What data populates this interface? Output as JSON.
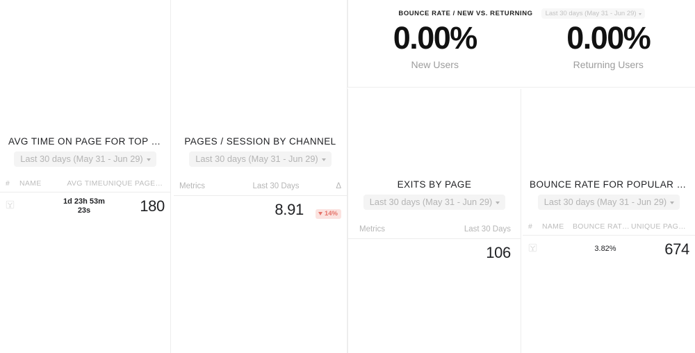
{
  "dashboard": {
    "panels": [
      {
        "id": "avg-time-on-page",
        "title": "AVG TIME ON PAGE FOR TOP PAG…",
        "date_range": "Last 30 days (May 31 - Jun 29)",
        "columns": [
          "#",
          "NAME",
          "AVG TIME",
          "UNIQUE PAGEVI…"
        ],
        "rows": [
          {
            "icon": "favicon-placeholder-icon",
            "name": "",
            "avg_time": "1d 23h 53m 23s",
            "unique_pageviews": "180"
          }
        ]
      },
      {
        "id": "pages-per-session-by-channel",
        "title": "PAGES / SESSION BY CHANNEL",
        "date_range": "Last 30 days (May 31 - Jun 29)",
        "columns": [
          "Metrics",
          "Last 30 Days",
          "Δ"
        ],
        "rows": [
          {
            "metric": "",
            "value": "8.91",
            "delta": "14%",
            "delta_direction": "down"
          }
        ]
      },
      {
        "id": "bounce-rate-new-vs-returning",
        "title": "BOUNCE RATE / NEW VS. RETURNING",
        "date_range": "Last 30 days (May 31 - Jun 29)",
        "stats": [
          {
            "value": "0.00%",
            "label": "New Users"
          },
          {
            "value": "0.00%",
            "label": "Returning Users"
          }
        ]
      },
      {
        "id": "exits-by-page",
        "title": "EXITS BY PAGE",
        "date_range": "Last 30 days (May 31 - Jun 29)",
        "columns": [
          "Metrics",
          "Last 30 Days"
        ],
        "rows": [
          {
            "metric": "",
            "value": "106"
          }
        ]
      },
      {
        "id": "bounce-rate-popular-pages",
        "title": "BOUNCE RATE FOR POPULAR PAG…",
        "date_range": "Last 30 days (May 31 - Jun 29)",
        "columns": [
          "#",
          "NAME",
          "BOUNCE RATE B…",
          "UNIQUE PAGEV…"
        ],
        "rows": [
          {
            "icon": "favicon-placeholder-icon",
            "name": "",
            "bounce_rate": "3.82%",
            "unique_pageviews": "674"
          }
        ]
      }
    ],
    "colors": {
      "background": "#ffffff",
      "text_primary": "#202124",
      "text_muted": "#b4b4b4",
      "border": "#ededed",
      "chip_background": "#f4f4f4",
      "delta_negative_bg": "#fbe3e0",
      "delta_negative_fg": "#e5736a"
    }
  }
}
